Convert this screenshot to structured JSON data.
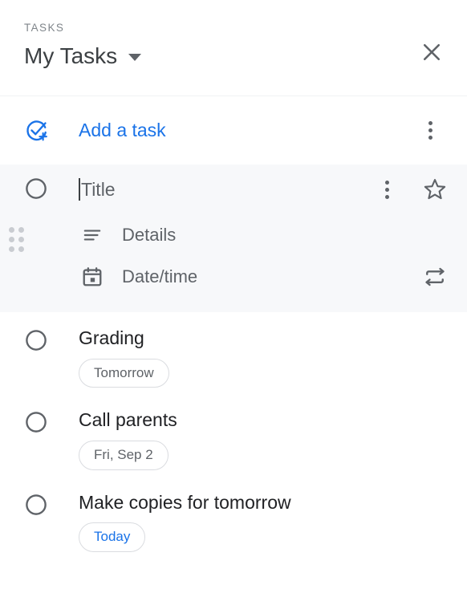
{
  "header": {
    "kicker": "TASKS",
    "list_name": "My Tasks",
    "caret_icon": "chevron-down-icon",
    "close_icon": "close-icon",
    "accent_color": "#1a73e8",
    "text_color": "#3c4043"
  },
  "add_task": {
    "label": "Add a task",
    "icon": "add-task-check-circle-icon",
    "overflow_icon": "more-vert-icon"
  },
  "new_task": {
    "checkbox_icon": "circle-unchecked-icon",
    "drag_handle_icon": "drag-handle-dots-icon",
    "title_placeholder": "Title",
    "title_value": "",
    "details_label": "Details",
    "details_icon": "details-lines-icon",
    "date_label": "Date/time",
    "date_icon": "calendar-icon",
    "overflow_icon": "more-vert-icon",
    "star_icon": "star-outline-icon",
    "repeat_icon": "repeat-icon",
    "panel_color": "#f7f8fa"
  },
  "tasks": [
    {
      "title": "Grading",
      "chip": "Tomorrow",
      "chip_style": "default",
      "checkbox_icon": "circle-unchecked-icon"
    },
    {
      "title": "Call parents",
      "chip": "Fri, Sep 2",
      "chip_style": "default",
      "checkbox_icon": "circle-unchecked-icon"
    },
    {
      "title": "Make copies for tomorrow",
      "chip": "Today",
      "chip_style": "today",
      "checkbox_icon": "circle-unchecked-icon"
    }
  ]
}
